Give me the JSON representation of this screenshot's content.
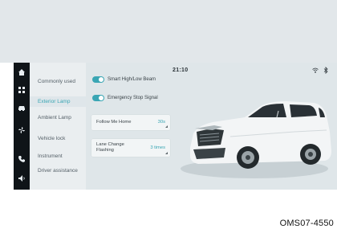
{
  "status_bar": {
    "time": "21:10",
    "icons": [
      "wifi-icon",
      "bluetooth-icon"
    ]
  },
  "rail": {
    "icons": [
      "home-icon",
      "apps-icon",
      "car-icon",
      "fan-icon",
      "phone-icon",
      "volume-icon"
    ]
  },
  "menu": {
    "items": [
      {
        "label": "Commonly used",
        "active": false
      },
      {
        "label": "Exterior Lamp",
        "active": true
      },
      {
        "label": "Ambient Lamp",
        "active": false
      },
      {
        "label": "Vehicle lock",
        "active": false
      },
      {
        "label": "Instrument",
        "active": false
      },
      {
        "label": "Driver assistance",
        "active": false
      }
    ]
  },
  "toggles": [
    {
      "label": "Smart High/Low Beam",
      "on": true
    },
    {
      "label": "Emergency Stop Signal",
      "on": true
    }
  ],
  "settings": [
    {
      "label": "Follow Me Home",
      "value": "30s"
    },
    {
      "label": "Lane Change Flashing",
      "value": "3 times"
    }
  ],
  "colors": {
    "accent": "#3aa6b4",
    "rail": "#0f1418",
    "panel": "#dfe6e9"
  },
  "doc_ref": "OMS07-4550"
}
